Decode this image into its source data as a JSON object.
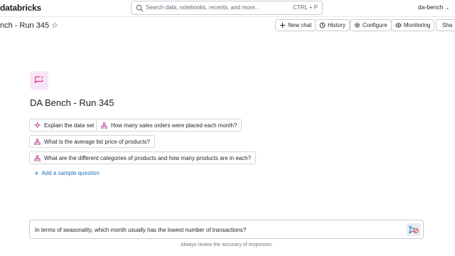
{
  "topbar": {
    "logo": "databricks",
    "search_placeholder": "Search data, notebooks, recents, and more...",
    "search_shortcut": "CTRL + P",
    "account": "da-bench"
  },
  "page": {
    "title": "nch - Run 345",
    "buttons": {
      "new_chat": "New chat",
      "history": "History",
      "configure": "Configure",
      "monitoring": "Monitoring",
      "share": "Sha"
    }
  },
  "hero": {
    "title": "DA Bench - Run 345"
  },
  "suggestions": [
    "Explain the data set",
    "How many sales orders were placed each month?",
    "What is the average list price of products?",
    "What are the different categories of products and how many products are in each?"
  ],
  "add_sample": "Add a sample question",
  "input": {
    "value": "In terms of seasonality, which month usually has the lowest number of transactions?"
  },
  "footer": "Always review the accuracy of responses.",
  "colors": {
    "link": "#2272b4",
    "accent_pink": "#e2338b",
    "send_bg": "#e7edf3"
  }
}
